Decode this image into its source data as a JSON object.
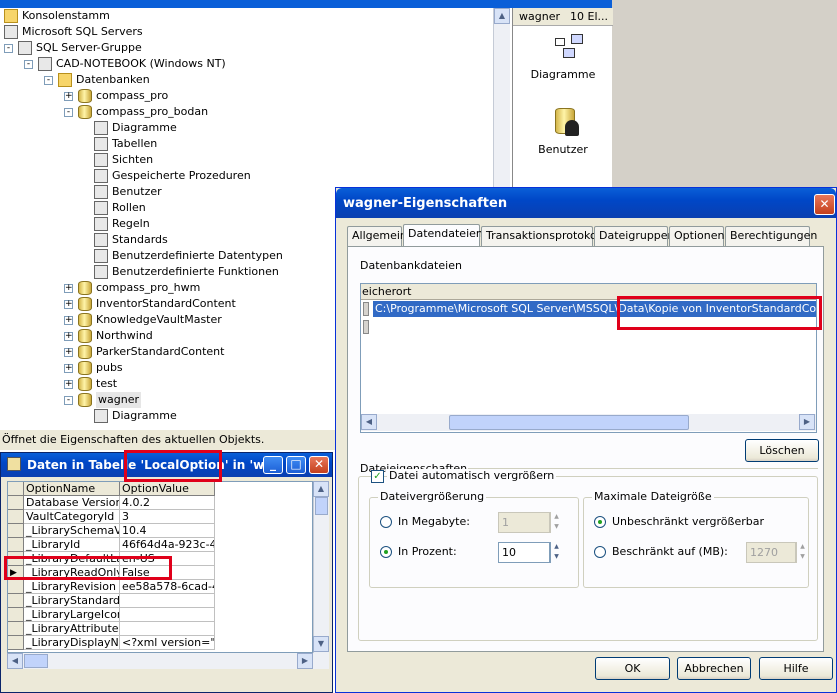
{
  "tree": {
    "items": [
      {
        "label": "Konsolenstamm",
        "depth": 0,
        "icon": "folder-icon"
      },
      {
        "label": "Microsoft SQL Servers",
        "depth": 0,
        "icon": "server-group-icon"
      },
      {
        "label": "SQL Server-Gruppe",
        "depth": 1,
        "icon": "server-group-icon"
      },
      {
        "label": "CAD-NOTEBOOK (Windows NT)",
        "depth": 2,
        "icon": "server-icon"
      },
      {
        "label": "Datenbanken",
        "depth": 3,
        "icon": "folder-icon"
      },
      {
        "label": "compass_pro",
        "depth": 4,
        "icon": "database-icon"
      },
      {
        "label": "compass_pro_bodan",
        "depth": 4,
        "icon": "database-icon"
      },
      {
        "label": "Diagramme",
        "depth": 5,
        "icon": "diagram-icon"
      },
      {
        "label": "Tabellen",
        "depth": 5,
        "icon": "table-icon"
      },
      {
        "label": "Sichten",
        "depth": 5,
        "icon": "view-icon"
      },
      {
        "label": "Gespeicherte Prozeduren",
        "depth": 5,
        "icon": "procedure-icon"
      },
      {
        "label": "Benutzer",
        "depth": 5,
        "icon": "user-icon"
      },
      {
        "label": "Rollen",
        "depth": 5,
        "icon": "role-icon"
      },
      {
        "label": "Regeln",
        "depth": 5,
        "icon": "rule-icon"
      },
      {
        "label": "Standards",
        "depth": 5,
        "icon": "default-icon"
      },
      {
        "label": "Benutzerdefinierte Datentypen",
        "depth": 5,
        "icon": "user-datatype-icon"
      },
      {
        "label": "Benutzerdefinierte Funktionen",
        "depth": 5,
        "icon": "user-function-icon"
      },
      {
        "label": "compass_pro_hwm",
        "depth": 4,
        "icon": "database-icon"
      },
      {
        "label": "InventorStandardContent",
        "depth": 4,
        "icon": "database-icon"
      },
      {
        "label": "KnowledgeVaultMaster",
        "depth": 4,
        "icon": "database-icon"
      },
      {
        "label": "Northwind",
        "depth": 4,
        "icon": "database-icon"
      },
      {
        "label": "ParkerStandardContent",
        "depth": 4,
        "icon": "database-icon"
      },
      {
        "label": "pubs",
        "depth": 4,
        "icon": "database-icon"
      },
      {
        "label": "test",
        "depth": 4,
        "icon": "database-icon"
      },
      {
        "label": "wagner",
        "depth": 4,
        "icon": "database-icon"
      },
      {
        "label": "Diagramme",
        "depth": 5,
        "icon": "diagram-icon"
      }
    ]
  },
  "right_pane": {
    "header_name": "wagner",
    "header_count": "10 El...",
    "items": [
      {
        "label": "Diagramme",
        "icon": "diagram-icon"
      },
      {
        "label": "Benutzer",
        "icon": "user-icon"
      }
    ]
  },
  "statusbar": "Öffnet die Eigenschaften des aktuellen Objekts.",
  "mini_window": {
    "title": "Daten in Tabelle 'LocalOption' in 'w...",
    "columns": [
      "OptionName",
      "OptionValue"
    ],
    "rows": [
      [
        "Database Version",
        "4.0.2"
      ],
      [
        "VaultCategoryId",
        "3"
      ],
      [
        "_LibrarySchemaVer",
        "10.4"
      ],
      [
        "_LibraryId",
        "46f64d4a-923c-45c"
      ],
      [
        "_LibraryDefaultLan",
        "en-US"
      ],
      [
        "_LibraryReadOnly",
        "False"
      ],
      [
        "_LibraryRevision",
        "ee58a578-6cad-48"
      ],
      [
        "_LibraryStandardIc",
        ""
      ],
      [
        "_LibraryLargeIcon",
        ""
      ],
      [
        "_LibraryAttributes",
        ""
      ],
      [
        "_LibraryDisplayNam",
        "<?xml version=\"1.0"
      ]
    ],
    "selected_row": 5
  },
  "dialog": {
    "title": "wagner-Eigenschaften",
    "tabs": [
      "Allgemein",
      "Datendateien",
      "Transaktionsprotokoll",
      "Dateigruppen",
      "Optionen",
      "Berechtigungen"
    ],
    "active_tab": "Datendateien",
    "files_label": "Datenbankdateien",
    "files_column": "eicherort",
    "file_path": "C:\\Programme\\Microsoft SQL Server\\MSSQL\\Data\\Kopie von InventorStandardContent.mdf",
    "delete_button": "Löschen",
    "props_label": "Dateieigenschaften",
    "auto_grow_label": "Datei automatisch vergrößern",
    "auto_grow_checked": true,
    "growth_group": "Dateivergrößerung",
    "in_mb_label": "In Megabyte:",
    "in_mb_value": "1",
    "in_percent_label": "In Prozent:",
    "in_percent_value": "10",
    "growth_mode": "percent",
    "maxsize_group": "Maximale Dateigröße",
    "unlimited_label": "Unbeschränkt vergrößerbar",
    "limited_label": "Beschränkt auf (MB):",
    "limited_value": "1270",
    "maxsize_mode": "unlimited",
    "ok": "OK",
    "cancel": "Abbrechen",
    "help": "Hilfe"
  },
  "colors": {
    "highlight": "#e0001a",
    "selection": "#316ac5",
    "title_blue": "#0a5fd8"
  }
}
